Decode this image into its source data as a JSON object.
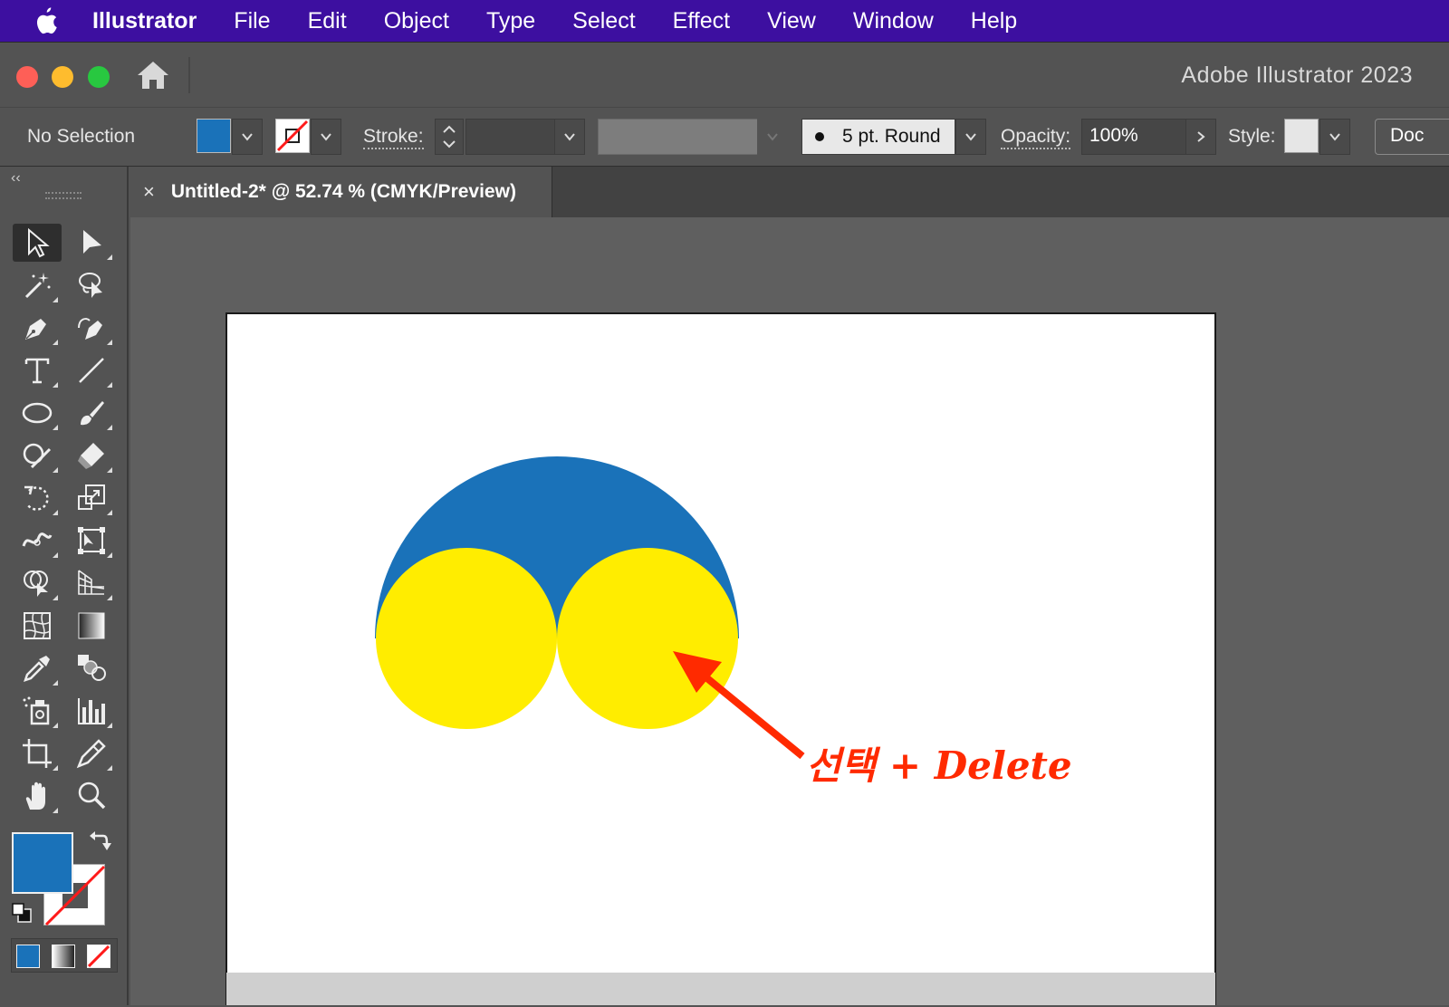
{
  "menubar": {
    "app_name": "Illustrator",
    "items": [
      "File",
      "Edit",
      "Object",
      "Type",
      "Select",
      "Effect",
      "View",
      "Window",
      "Help"
    ]
  },
  "window": {
    "title": "Adobe Illustrator 2023"
  },
  "controlbar": {
    "selection": "No Selection",
    "fill_color": "#1a72b9",
    "stroke_label": "Stroke:",
    "brush": "5 pt. Round",
    "opacity_label": "Opacity:",
    "opacity_value": "100%",
    "style_label": "Style:",
    "doc_button": "Doc"
  },
  "document": {
    "tab_title": "Untitled-2* @ 52.74 % (CMYK/Preview)",
    "close_glyph": "×"
  },
  "toolbar": {
    "collapse_glyph": "‹‹",
    "fill_color": "#1a72b9",
    "stroke": "none"
  },
  "artwork": {
    "big_circle_color": "#1a72b9",
    "small_circle_color": "#ffed00",
    "annotation": "선택 + Delete",
    "annotation_color": "#ff2a00"
  }
}
